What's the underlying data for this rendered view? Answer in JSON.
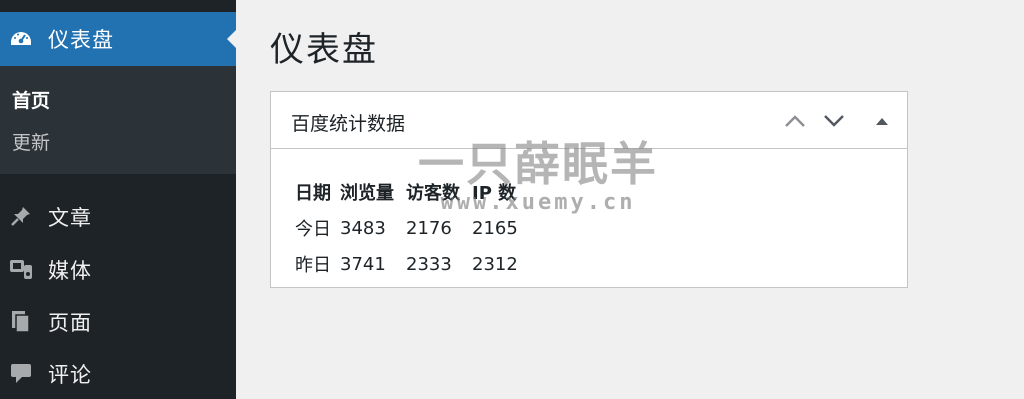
{
  "sidebar": {
    "active": {
      "label": "仪表盘",
      "icon": "dashboard-icon"
    },
    "submenu": [
      {
        "label": "首页",
        "current": true
      },
      {
        "label": "更新",
        "current": false
      }
    ],
    "items": [
      {
        "label": "文章",
        "icon": "pushpin-icon"
      },
      {
        "label": "媒体",
        "icon": "media-icon"
      },
      {
        "label": "页面",
        "icon": "pages-icon"
      },
      {
        "label": "评论",
        "icon": "comment-icon"
      }
    ]
  },
  "main": {
    "title": "仪表盘",
    "widget": {
      "title": "百度统计数据",
      "headers": [
        "日期",
        "浏览量",
        "访客数",
        "IP 数"
      ],
      "rows": [
        [
          "今日",
          "3483",
          "2176",
          "2165"
        ],
        [
          "昨日",
          "3741",
          "2333",
          "2312"
        ]
      ]
    }
  },
  "watermark": {
    "line1": "一只薛眠羊",
    "line2": "www.xuemy.cn"
  },
  "colors": {
    "sidebar_bg": "#1d2327",
    "submenu_bg": "#2c3338",
    "accent": "#2271b1",
    "page_bg": "#f0f0f1"
  }
}
